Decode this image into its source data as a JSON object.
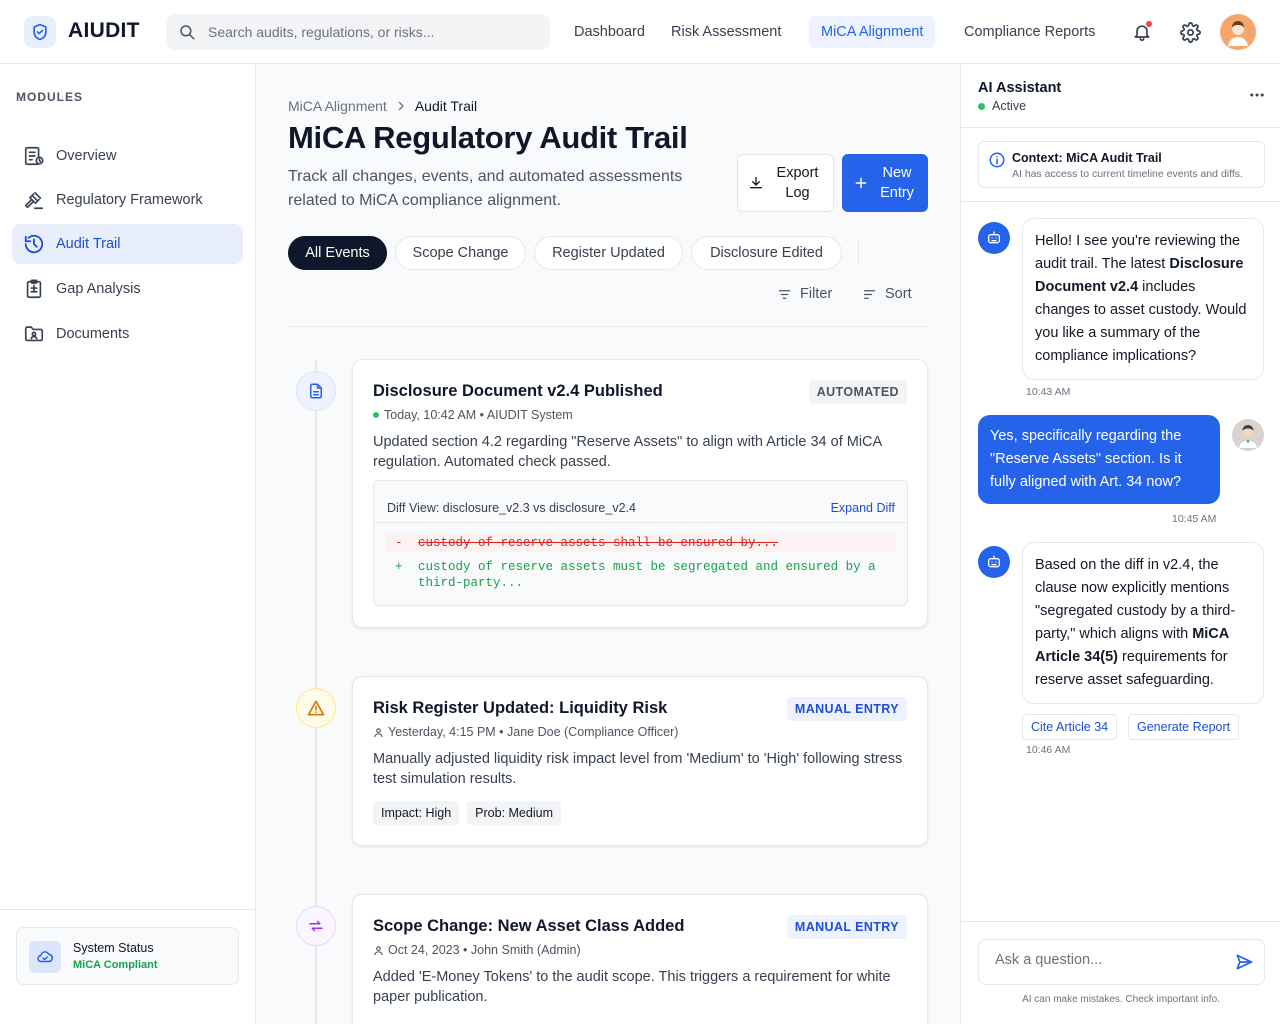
{
  "brand": {
    "name": "AIUDIT"
  },
  "search": {
    "placeholder": "Search audits, regulations, or risks..."
  },
  "nav": {
    "items": [
      {
        "label": "Dashboard"
      },
      {
        "label": "Risk Assessment"
      },
      {
        "label": "MiCA Alignment",
        "active": true
      },
      {
        "label": "Compliance Reports"
      }
    ]
  },
  "sidebar": {
    "heading": "MODULES",
    "items": [
      {
        "label": "Overview",
        "icon": "overview-icon"
      },
      {
        "label": "Regulatory Framework",
        "icon": "gavel-icon"
      },
      {
        "label": "Audit Trail",
        "icon": "history-icon",
        "active": true
      },
      {
        "label": "Gap Analysis",
        "icon": "clipboard-icon"
      },
      {
        "label": "Documents",
        "icon": "folder-icon"
      }
    ],
    "status": {
      "title": "System Status",
      "value": "MiCA Compliant"
    }
  },
  "main": {
    "breadcrumb": {
      "parent": "MiCA Alignment",
      "current": "Audit Trail"
    },
    "title": "MiCA Regulatory Audit Trail",
    "description": "Track all changes, events, and automated assessments related to MiCA compliance alignment.",
    "export_label": "Export Log",
    "new_label": "New Entry",
    "filters": [
      {
        "label": "All Events",
        "active": true
      },
      {
        "label": "Scope Change"
      },
      {
        "label": "Register Updated"
      },
      {
        "label": "Disclosure Edited"
      }
    ],
    "filter_label": "Filter",
    "sort_label": "Sort",
    "events": [
      {
        "title": "Disclosure Document v2.4 Published",
        "badge": "AUTOMATED",
        "meta": "Today, 10:42 AM • AIUDIT System",
        "text": "Updated section 4.2 regarding \"Reserve Assets\" to align with Article 34 of MiCA regulation. Automated check passed.",
        "diff": {
          "file": "Diff View: disclosure_v2.3 vs disclosure_v2.4",
          "expand": "Expand Diff",
          "removed_sign": "-",
          "removed": "custody of reserve assets shall be ensured by...",
          "added_sign": "+",
          "added": "custody of reserve assets must be segregated and ensured by a third-party..."
        }
      },
      {
        "title": "Risk Register Updated: Liquidity Risk",
        "badge": "MANUAL ENTRY",
        "meta": "Yesterday, 4:15 PM • Jane Doe (Compliance Officer)",
        "text": "Manually adjusted liquidity risk impact level from 'Medium' to 'High' following stress test simulation results.",
        "tags": [
          "Impact: High",
          "Prob: Medium"
        ]
      },
      {
        "title": "Scope Change: New Asset Class Added",
        "badge": "MANUAL ENTRY",
        "meta": "Oct 24, 2023 • John Smith (Admin)",
        "text": "Added 'E-Money Tokens' to the audit scope. This triggers a requirement for white paper publication."
      }
    ]
  },
  "ai": {
    "title": "AI Assistant",
    "status": "Active",
    "context": {
      "title": "Context: MiCA Audit Trail",
      "subtitle": "AI has access to current timeline events and diffs."
    },
    "messages": [
      {
        "role": "bot",
        "parts": [
          "Hello! I see you're reviewing the audit trail. The latest ",
          "Disclosure Document v2.4",
          " includes changes to asset custody. Would you like a summary of the compliance implications?"
        ],
        "time": "10:43 AM"
      },
      {
        "role": "user",
        "text": "Yes, specifically regarding the \"Reserve Assets\" section. Is it fully aligned with Art. 34 now?",
        "time": "10:45 AM"
      },
      {
        "role": "bot",
        "parts": [
          "Based on the diff in v2.4, the clause now explicitly mentions \"segregated custody by a third-party,\" which aligns with ",
          "MiCA Article 34(5)",
          " requirements for reserve asset safeguarding."
        ],
        "time": "10:46 AM"
      }
    ],
    "actions": [
      "Cite Article 34",
      "Generate Report"
    ],
    "input_placeholder": "Ask a question...",
    "disclaimer": "AI can make mistakes. Check important info."
  },
  "colors": {
    "accent": "#2563eb",
    "success": "#22c55e",
    "warning": "#f59e0b",
    "purple": "#9333ea",
    "danger": "#dc2626"
  }
}
